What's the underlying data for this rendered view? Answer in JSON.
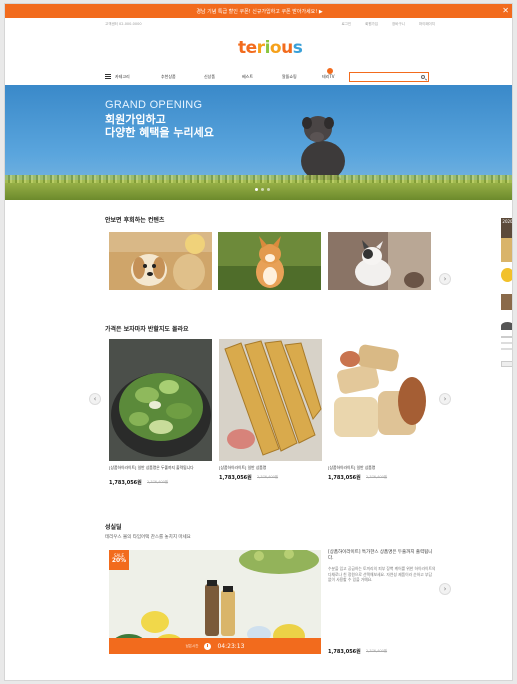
{
  "topbar": {
    "text": "경남 기념 특급 할인 쿠폰! 신규가입하고 쿠폰 받아가세요! ▶",
    "close": "✕"
  },
  "util": {
    "left": "고객센터 02-000-0000",
    "links": [
      "로그인",
      "회원가입",
      "장바구니",
      "마이페이지"
    ]
  },
  "logo": {
    "letters": [
      "t",
      "e",
      "r",
      "i",
      "o",
      "u",
      "s"
    ],
    "colors": [
      "#f26b1d",
      "#f26b1d",
      "#f5a11b",
      "#8ac640",
      "#f5a11b",
      "#f26b1d",
      "#3aa0d8"
    ]
  },
  "nav": {
    "items": [
      "카테고리",
      "추천상품",
      "신상품",
      "베스트",
      "알뜰쇼핑",
      "테리TV"
    ],
    "search_placeholder": ""
  },
  "hero": {
    "eyebrow": "GRAND OPENING",
    "headline": "회원가입하고\n다양한 혜택을 누리세요"
  },
  "section1": {
    "title": "안보면 후회하는 컨텐츠"
  },
  "section2": {
    "title": "가격은 보자마자 반할지도 몰라요",
    "products": [
      {
        "name": "[상품하이라이트] 일반 상품명은 두줄까지 출력됩니다",
        "price": "1,783,056원",
        "old": "2,376,400원"
      },
      {
        "name": "[상품하이라이트] 일반 상품명",
        "price": "1,783,056원",
        "old": "2,376,400원"
      },
      {
        "name": "[상품하이라이트] 일반 상품명",
        "price": "1,783,056원",
        "old": "2,376,400원"
      }
    ]
  },
  "section3": {
    "title": "성실딜",
    "subtitle": "테리우스 몰의 타임어택 찬스를 놓치지 마세요",
    "badge_top": "SALE",
    "badge_pct": "20%",
    "timer_label": "남은시간",
    "timer": "04:23:13",
    "deal_title": "[상품하이라이트] 특가한스 상품명은 두줄까지 출력됩니다.",
    "deal_desc": "수분을 입고 공급하는 토끼리의 피부 장벽 케어를 위한 하이라이트의 다채로나 친 정원으로 선택해보세요. 자연성 제품이라 순하고 부담 없이 사용할 수 있을 거예요.",
    "price": "1,783,056원",
    "old": "2,376,400원"
  },
  "arrows": {
    "next": "›",
    "prev": "‹"
  },
  "rail": {
    "year": "2020"
  }
}
